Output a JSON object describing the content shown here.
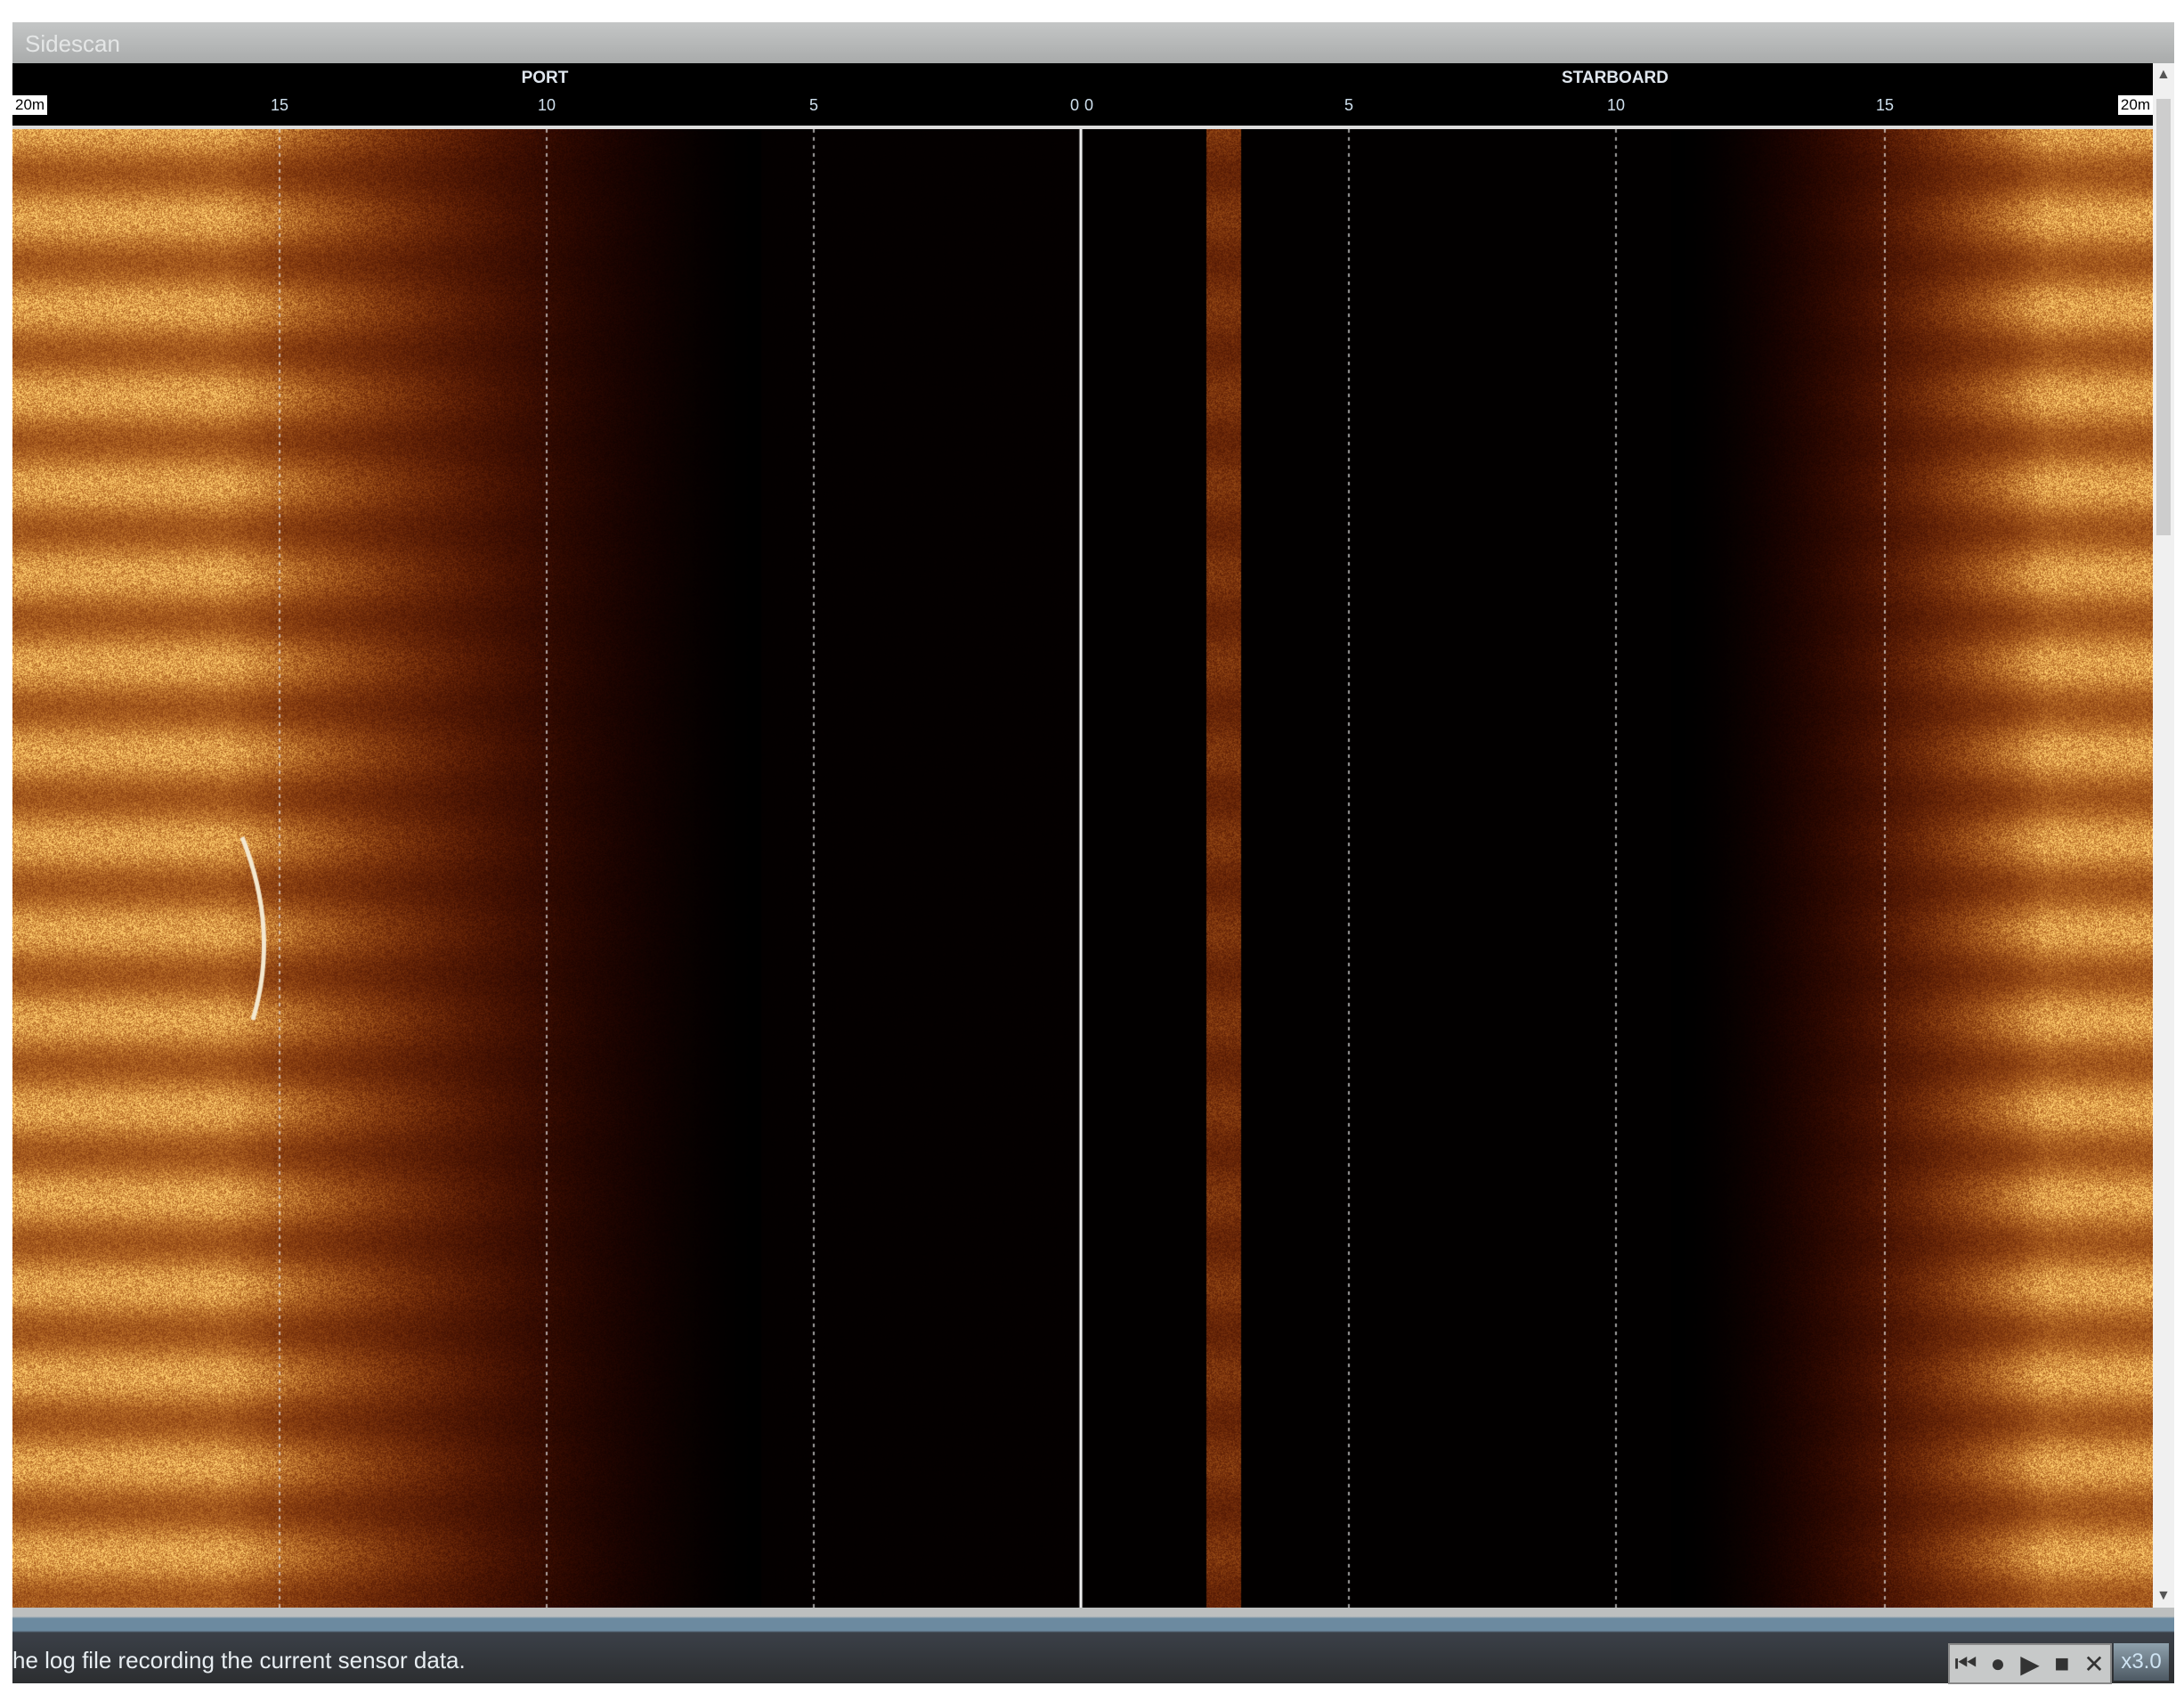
{
  "window": {
    "title": "Sidescan"
  },
  "ruler": {
    "port_label": "PORT",
    "starboard_label": "STARBOARD",
    "port_ticks": [
      "15",
      "10",
      "5",
      "0"
    ],
    "starboard_ticks": [
      "0",
      "5",
      "10",
      "15"
    ],
    "left_end": "20m",
    "right_end": "20m"
  },
  "status": {
    "text": "he log file recording the current sensor data."
  },
  "controls": {
    "buttons": [
      {
        "name": "skip-start",
        "glyph": "⏮"
      },
      {
        "name": "record",
        "glyph": "●"
      },
      {
        "name": "play",
        "glyph": "▶"
      },
      {
        "name": "stop",
        "glyph": "■"
      },
      {
        "name": "close",
        "glyph": "✕"
      }
    ],
    "speed": "x3.0"
  },
  "colors": {
    "sonar": "#d9a25a",
    "background": "#000000"
  }
}
